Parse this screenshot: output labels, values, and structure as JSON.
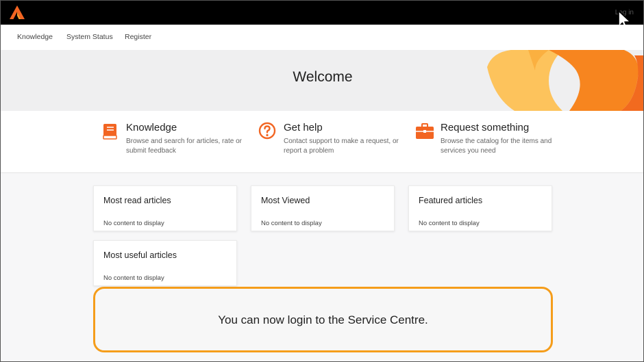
{
  "header": {
    "login_label": "Log in"
  },
  "nav": {
    "items": [
      {
        "label": "Knowledge"
      },
      {
        "label": "System Status"
      },
      {
        "label": "Register"
      }
    ]
  },
  "hero": {
    "title": "Welcome"
  },
  "categories": [
    {
      "title": "Knowledge",
      "description": "Browse and search for articles, rate or submit feedback",
      "icon": "book-icon"
    },
    {
      "title": "Get help",
      "description": "Contact support to make a request, or report a problem",
      "icon": "question-icon"
    },
    {
      "title": "Request something",
      "description": "Browse the catalog for the items and services you need",
      "icon": "briefcase-icon"
    }
  ],
  "widgets": [
    {
      "title": "Most read articles",
      "empty_text": "No content to display"
    },
    {
      "title": "Most Viewed",
      "empty_text": "No content to display"
    },
    {
      "title": "Featured articles",
      "empty_text": "No content to display"
    },
    {
      "title": "Most useful articles",
      "empty_text": "No content to display"
    }
  ],
  "caption": {
    "text": "You can now login to the Service Centre."
  },
  "colors": {
    "accent": "#f26522",
    "caption_border": "#f59d1b",
    "topbar": "#000000",
    "hero_bg": "#efeff0"
  }
}
